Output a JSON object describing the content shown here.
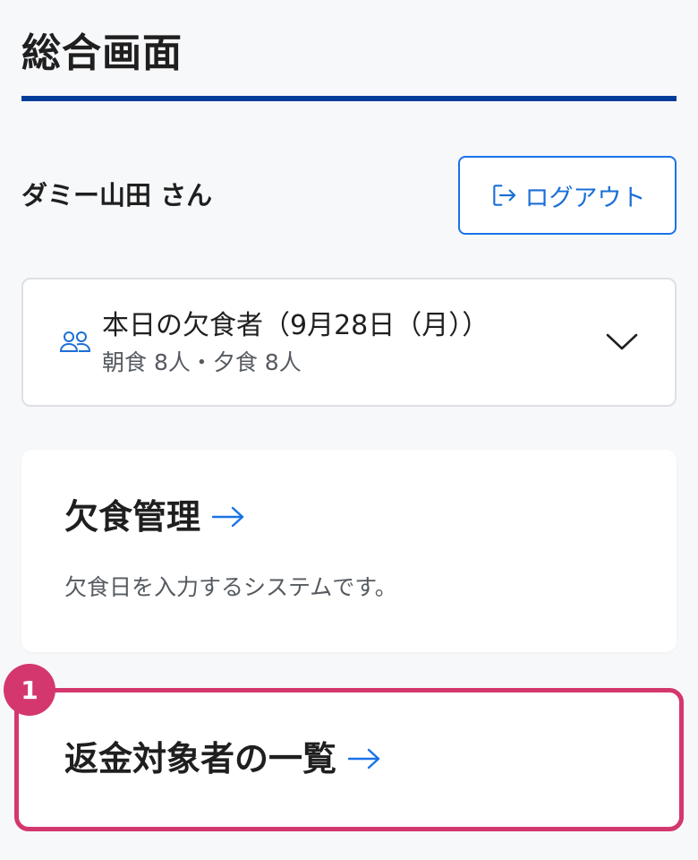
{
  "header": {
    "title": "総合画面"
  },
  "user": {
    "greeting": "ダミー山田 さん"
  },
  "logout": {
    "label": "ログアウト",
    "icon": "logout-icon"
  },
  "absence_panel": {
    "icon": "people-icon",
    "title": "本日の欠食者（9月28日（月））",
    "summary": "朝食 8人・夕食 8人"
  },
  "cards": [
    {
      "title": "欠食管理",
      "description": "欠食日を入力するシステムです。"
    },
    {
      "title": "返金対象者の一覧",
      "badge": "1"
    }
  ],
  "colors": {
    "accent": "#1a73e8",
    "title_rule": "#003d99",
    "highlight": "#d4376e"
  }
}
